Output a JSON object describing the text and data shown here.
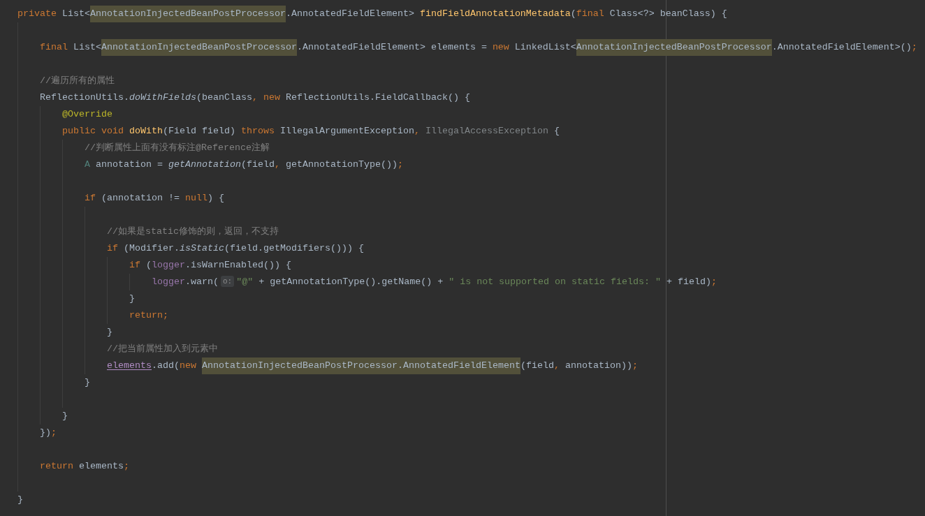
{
  "editor": {
    "lines": [
      {
        "kind": "code",
        "tokens": [
          {
            "text": "private",
            "kind": "keyword"
          },
          {
            "text": " List<",
            "kind": "plain"
          },
          {
            "text": "AnnotationInjectedBeanPostProcessor",
            "kind": "match"
          },
          {
            "text": ".AnnotatedFieldElement> ",
            "kind": "plain"
          },
          {
            "text": "findFieldAnnotationMetadata",
            "kind": "declaration"
          },
          {
            "text": "(",
            "kind": "plain"
          },
          {
            "text": "final",
            "kind": "keyword"
          },
          {
            "text": " Class<?> beanClass) {",
            "kind": "plain"
          }
        ],
        "children": [
          {
            "kind": "blank"
          },
          {
            "kind": "code",
            "tokens": [
              {
                "text": "final",
                "kind": "keyword"
              },
              {
                "text": " List<",
                "kind": "plain"
              },
              {
                "text": "AnnotationInjectedBeanPostProcessor",
                "kind": "match"
              },
              {
                "text": ".AnnotatedFieldElement> elements = ",
                "kind": "plain"
              },
              {
                "text": "new",
                "kind": "keyword"
              },
              {
                "text": " LinkedList<",
                "kind": "plain"
              },
              {
                "text": "AnnotationInjectedBeanPostProcessor",
                "kind": "match"
              },
              {
                "text": ".AnnotatedFieldElement>()",
                "kind": "plain"
              },
              {
                "text": ";",
                "kind": "keyword"
              }
            ]
          },
          {
            "kind": "blank"
          },
          {
            "kind": "code",
            "tokens": [
              {
                "text": "//遍历所有的属性",
                "kind": "comment"
              }
            ]
          },
          {
            "kind": "code",
            "tokens": [
              {
                "text": "ReflectionUtils.",
                "kind": "plain"
              },
              {
                "text": "doWithFields",
                "kind": "static"
              },
              {
                "text": "(beanClass",
                "kind": "plain"
              },
              {
                "text": ", new",
                "kind": "keyword"
              },
              {
                "text": " ReflectionUtils.FieldCallback() {",
                "kind": "plain"
              }
            ],
            "children": [
              {
                "kind": "code",
                "tokens": [
                  {
                    "text": "@Override",
                    "kind": "annotation"
                  }
                ]
              },
              {
                "kind": "code",
                "tokens": [
                  {
                    "text": "public void ",
                    "kind": "keyword"
                  },
                  {
                    "text": "doWith",
                    "kind": "declaration"
                  },
                  {
                    "text": "(Field field) ",
                    "kind": "plain"
                  },
                  {
                    "text": "throws",
                    "kind": "keyword"
                  },
                  {
                    "text": " IllegalArgumentException",
                    "kind": "plain"
                  },
                  {
                    "text": ", ",
                    "kind": "keyword"
                  },
                  {
                    "text": "IllegalAccessException",
                    "kind": "unused"
                  },
                  {
                    "text": " {",
                    "kind": "plain"
                  }
                ],
                "children": [
                  {
                    "kind": "code",
                    "tokens": [
                      {
                        "text": "//判断属性上面有没有标注@Reference注解",
                        "kind": "comment"
                      }
                    ]
                  },
                  {
                    "kind": "code",
                    "tokens": [
                      {
                        "text": "A",
                        "kind": "type-parameter"
                      },
                      {
                        "text": " annotation = ",
                        "kind": "plain"
                      },
                      {
                        "text": "getAnnotation",
                        "kind": "static"
                      },
                      {
                        "text": "(field",
                        "kind": "plain"
                      },
                      {
                        "text": ", ",
                        "kind": "keyword"
                      },
                      {
                        "text": "getAnnotationType())",
                        "kind": "plain"
                      },
                      {
                        "text": ";",
                        "kind": "keyword"
                      }
                    ]
                  },
                  {
                    "kind": "blank"
                  },
                  {
                    "kind": "code",
                    "tokens": [
                      {
                        "text": "if",
                        "kind": "keyword"
                      },
                      {
                        "text": " (annotation != ",
                        "kind": "plain"
                      },
                      {
                        "text": "null",
                        "kind": "keyword"
                      },
                      {
                        "text": ") {",
                        "kind": "plain"
                      }
                    ],
                    "children": [
                      {
                        "kind": "blank"
                      },
                      {
                        "kind": "code",
                        "tokens": [
                          {
                            "text": "//如果是static修饰的则，返回，不支持",
                            "kind": "comment"
                          }
                        ]
                      },
                      {
                        "kind": "code",
                        "tokens": [
                          {
                            "text": "if",
                            "kind": "keyword"
                          },
                          {
                            "text": " (Modifier.",
                            "kind": "plain"
                          },
                          {
                            "text": "isStatic",
                            "kind": "static"
                          },
                          {
                            "text": "(field.getModifiers())) {",
                            "kind": "plain"
                          }
                        ],
                        "children": [
                          {
                            "kind": "code",
                            "tokens": [
                              {
                                "text": "if",
                                "kind": "keyword"
                              },
                              {
                                "text": " (",
                                "kind": "plain"
                              },
                              {
                                "text": "logger",
                                "kind": "field"
                              },
                              {
                                "text": ".isWarnEnabled()) {",
                                "kind": "plain"
                              }
                            ],
                            "children": [
                              {
                                "kind": "code",
                                "tokens": [
                                  {
                                    "text": "logger",
                                    "kind": "field"
                                  },
                                  {
                                    "text": ".warn(",
                                    "kind": "plain"
                                  },
                                  {
                                    "text": "o:",
                                    "kind": "hint"
                                  },
                                  {
                                    "text": "\"@\"",
                                    "kind": "string"
                                  },
                                  {
                                    "text": " + getAnnotationType().getName() + ",
                                    "kind": "plain"
                                  },
                                  {
                                    "text": "\" is not supported on static fields: \"",
                                    "kind": "string"
                                  },
                                  {
                                    "text": " + field)",
                                    "kind": "plain"
                                  },
                                  {
                                    "text": ";",
                                    "kind": "keyword"
                                  }
                                ]
                              }
                            ]
                          },
                          {
                            "kind": "code",
                            "tokens": [
                              {
                                "text": "}",
                                "kind": "plain"
                              }
                            ]
                          },
                          {
                            "kind": "code",
                            "tokens": [
                              {
                                "text": "return;",
                                "kind": "keyword"
                              }
                            ]
                          }
                        ]
                      },
                      {
                        "kind": "code",
                        "tokens": [
                          {
                            "text": "}",
                            "kind": "plain"
                          }
                        ]
                      },
                      {
                        "kind": "code",
                        "tokens": [
                          {
                            "text": "//把当前属性加入到元素中",
                            "kind": "comment"
                          }
                        ]
                      },
                      {
                        "kind": "code",
                        "tokens": [
                          {
                            "text": "elements",
                            "kind": "reassigned"
                          },
                          {
                            "text": ".add(",
                            "kind": "plain"
                          },
                          {
                            "text": "new ",
                            "kind": "keyword"
                          },
                          {
                            "text": "AnnotationInjectedBeanPostProcessor.AnnotatedFieldElement",
                            "kind": "match"
                          },
                          {
                            "text": "(field",
                            "kind": "plain"
                          },
                          {
                            "text": ", ",
                            "kind": "keyword"
                          },
                          {
                            "text": "annotation))",
                            "kind": "plain"
                          },
                          {
                            "text": ";",
                            "kind": "keyword"
                          }
                        ]
                      }
                    ]
                  },
                  {
                    "kind": "code",
                    "tokens": [
                      {
                        "text": "}",
                        "kind": "plain"
                      }
                    ]
                  },
                  {
                    "kind": "blank"
                  }
                ]
              },
              {
                "kind": "code",
                "tokens": [
                  {
                    "text": "}",
                    "kind": "plain"
                  }
                ]
              }
            ]
          },
          {
            "kind": "code",
            "tokens": [
              {
                "text": "})",
                "kind": "plain"
              },
              {
                "text": ";",
                "kind": "keyword"
              }
            ]
          },
          {
            "kind": "blank"
          },
          {
            "kind": "code",
            "tokens": [
              {
                "text": "return",
                "kind": "keyword"
              },
              {
                "text": " elements",
                "kind": "plain"
              },
              {
                "text": ";",
                "kind": "keyword"
              }
            ]
          },
          {
            "kind": "blank"
          }
        ]
      },
      {
        "kind": "code",
        "tokens": [
          {
            "text": "}",
            "kind": "plain"
          }
        ]
      }
    ]
  }
}
